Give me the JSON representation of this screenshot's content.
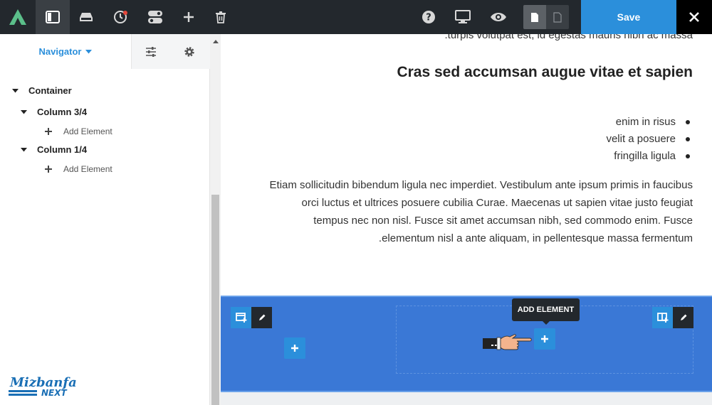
{
  "toolbar": {
    "save_label": "Save",
    "icons": [
      "logo-icon",
      "navigator-icon",
      "section-icon",
      "history-icon",
      "toggle-icon",
      "add-icon",
      "trash-icon",
      "help-icon",
      "desktop-icon",
      "preview-icon",
      "page-icon",
      "page-outline-icon",
      "close-icon"
    ],
    "accent": "#2b8fdb",
    "bar_color": "#23282d"
  },
  "sidebar": {
    "tab_navigator": "Navigator",
    "tree": {
      "container": "Container",
      "column1": "Column 3/4",
      "column1_add": "Add Element",
      "column2": "Column 1/4",
      "column2_add": "Add Element"
    },
    "brand_top": "Mizbanfa",
    "brand_bottom": "NEXT"
  },
  "canvas": {
    "cut_text": "turpis volutpat est, id egestas mauris nibh ac massa.",
    "heading": "Cras sed accumsan augue vitae et sapien",
    "list": [
      "enim in risus",
      "velit a posuere",
      "fringilla ligula"
    ],
    "paragraph": [
      "Etiam sollicitudin bibendum ligula nec imperdiet. Vestibulum ante ipsum primis in faucibus",
      "orci luctus et ultrices posuere cubilia Curae. Maecenas ut sapien vitae justo feugiat",
      "tempus nec non nisl. Fusce sit amet accumsan nibh, sed commodo enim. Fusce",
      "elementum nisl a ante aliquam, in pellentesque massa fermentum."
    ],
    "tooltip": "ADD ELEMENT",
    "section_color": "#3a78d6"
  }
}
